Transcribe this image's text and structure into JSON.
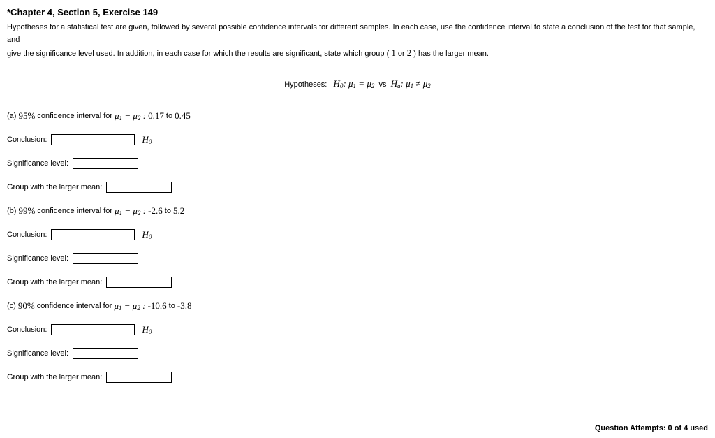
{
  "title": "*Chapter 4, Section 5, Exercise 149",
  "intro_line1": "Hypotheses for a statistical test are given, followed by several possible confidence intervals for different samples. In each case, use the confidence interval to state a conclusion of the test for that sample, and",
  "intro_prefix": "give the significance level used. In addition, in each case for which the results are significant, state which group ( ",
  "intro_or": " or ",
  "intro_suffix": " ) has the larger mean.",
  "one": "1",
  "two": "2",
  "hyp_label": "Hypotheses:",
  "vs": "vs",
  "parts": {
    "a": {
      "tag": "(a)",
      "pct": "95%",
      "ci_label": "confidence interval for",
      "lo": "0.17",
      "to": "to",
      "hi": "0.45"
    },
    "b": {
      "tag": "(b)",
      "pct": "99%",
      "ci_label": "confidence interval for",
      "lo": "-2.6",
      "to": "to",
      "hi": "5.2"
    },
    "c": {
      "tag": "(c)",
      "pct": "90%",
      "ci_label": "confidence interval for",
      "lo": "-10.6",
      "to": "to",
      "hi": "-3.8"
    }
  },
  "labels": {
    "conclusion": "Conclusion:",
    "sig": "Significance level:",
    "group": "Group with the larger mean:"
  },
  "footer": "Question Attempts: 0 of 4 used"
}
